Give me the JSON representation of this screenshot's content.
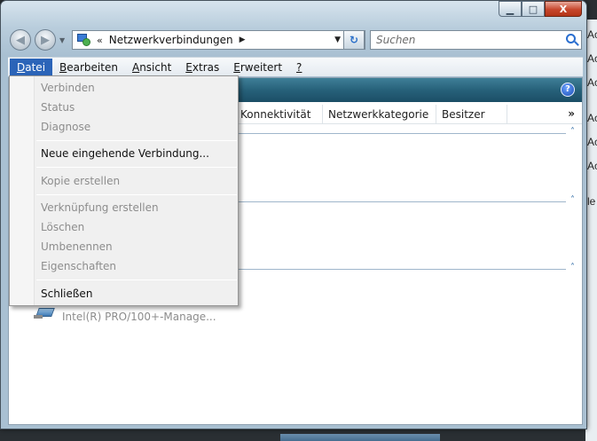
{
  "window": {
    "caption_min": "▁",
    "caption_max": "□",
    "caption_close": "X"
  },
  "navigation": {
    "back_glyph": "◀",
    "forward_glyph": "▶",
    "address_prefix": "«",
    "address_path": "Netzwerkverbindungen",
    "address_arrow": "▶",
    "address_dropdown": "▼",
    "refresh_glyph": "↻",
    "search_placeholder": "Suchen"
  },
  "menubar": {
    "items": [
      {
        "accel": "D",
        "rest": "atei"
      },
      {
        "accel": "B",
        "rest": "earbeiten"
      },
      {
        "accel": "A",
        "rest": "nsicht"
      },
      {
        "accel": "E",
        "rest": "xtras",
        "prefix": ""
      },
      {
        "accel": "E",
        "rest": "rweitert"
      },
      {
        "accel": "?",
        "rest": ""
      }
    ]
  },
  "columns": {
    "connectivity": "Konnektivität",
    "category": "Netzwerkkategorie",
    "owner": "Besitzer",
    "more": "»"
  },
  "commandbar": {
    "help_label": "?"
  },
  "groups": {
    "chevron": "˄"
  },
  "connection": {
    "adapter": "Intel(R) PRO/100+-Manage..."
  },
  "dropdown": {
    "items": [
      {
        "label": "Verbinden",
        "enabled": false
      },
      {
        "label": "Status",
        "enabled": false
      },
      {
        "label": "Diagnose",
        "enabled": false
      },
      {
        "label": "Neue eingehende Verbindung...",
        "enabled": true
      },
      {
        "label": "Kopie erstellen",
        "enabled": false
      },
      {
        "label": "Verknüpfung erstellen",
        "enabled": false
      },
      {
        "label": "Löschen",
        "enabled": false
      },
      {
        "label": "Umbenennen",
        "enabled": false
      },
      {
        "label": "Eigenschaften",
        "enabled": false
      },
      {
        "label": "Schließen",
        "enabled": true
      }
    ]
  },
  "desktop": {
    "right_labels": [
      "Ac",
      "Ac",
      "Ac",
      "Ac",
      "Ac",
      "Ac",
      "le"
    ]
  }
}
